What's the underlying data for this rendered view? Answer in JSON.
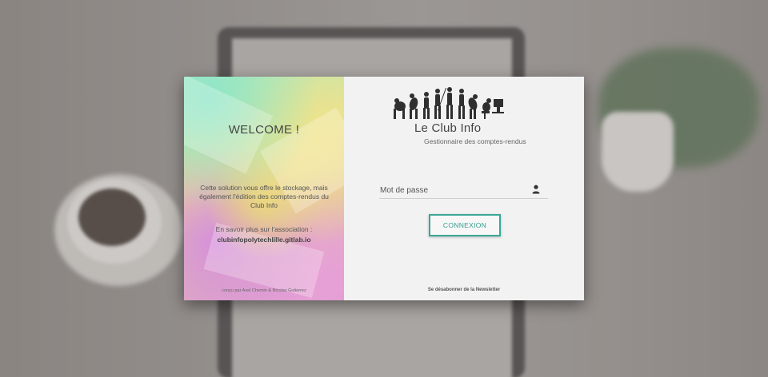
{
  "left_panel": {
    "welcome": "WELCOME !",
    "description": "Cette solution vous offre le stockage, mais également l'édition des comptes-rendus du Club Info",
    "more_info": "En savoir plus sur l'association :",
    "association_link": "clubinfopolytechlille.gitlab.io",
    "credits": "conçu par Axel Chemin & Nicolas Gutierrez"
  },
  "right_panel": {
    "logo_title": "Le Club Info",
    "logo_subtitle": "Gestionnaire des comptes-rendus",
    "password_placeholder": "Mot de passe",
    "password_icon": "user-icon",
    "connect_label": "CONNEXION",
    "unsubscribe_link": "Se désabonner de la Newsletter"
  },
  "colors": {
    "accent": "#3aa896",
    "panel_bg": "#f2f2f2"
  }
}
